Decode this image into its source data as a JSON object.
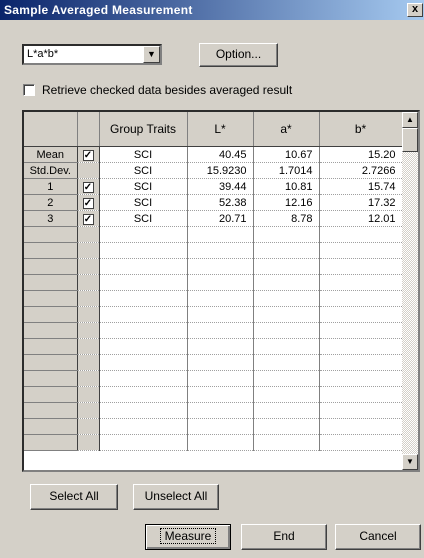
{
  "window": {
    "title": "Sample Averaged Measurement",
    "close": "x"
  },
  "display_mode": {
    "selected": "L*a*b*"
  },
  "option_button": "Option...",
  "retrieve_checkbox": {
    "label": "Retrieve checked data besides averaged result",
    "checked": false
  },
  "table": {
    "headers": [
      "",
      "",
      "Group Traits",
      "L*",
      "a*",
      "b*"
    ],
    "rows": [
      {
        "label": "Mean",
        "checked": true,
        "group": "SCI",
        "L": "40.45",
        "a": "10.67",
        "b": "15.20"
      },
      {
        "label": "Std.Dev.",
        "checked": false,
        "group": "SCI",
        "L": "15.9230",
        "a": "1.7014",
        "b": "2.7266"
      },
      {
        "label": "1",
        "checked": true,
        "group": "SCI",
        "L": "39.44",
        "a": "10.81",
        "b": "15.74"
      },
      {
        "label": "2",
        "checked": true,
        "group": "SCI",
        "L": "52.38",
        "a": "12.16",
        "b": "17.32"
      },
      {
        "label": "3",
        "checked": true,
        "group": "SCI",
        "L": "20.71",
        "a": "8.78",
        "b": "12.01"
      }
    ],
    "empty_rows": 14
  },
  "buttons": {
    "select_all": "Select All",
    "unselect_all": "Unselect All",
    "measure": "Measure",
    "end": "End",
    "cancel": "Cancel"
  },
  "icons": {
    "combo_arrow": "chevron-down-icon",
    "scroll_up": "arrow-up-icon",
    "scroll_down": "arrow-down-icon",
    "checkmark": "check-icon"
  },
  "colors": {
    "title_bar_start": "#0a246a",
    "title_bar_end": "#a6caf0",
    "face": "#d4d0c8"
  }
}
